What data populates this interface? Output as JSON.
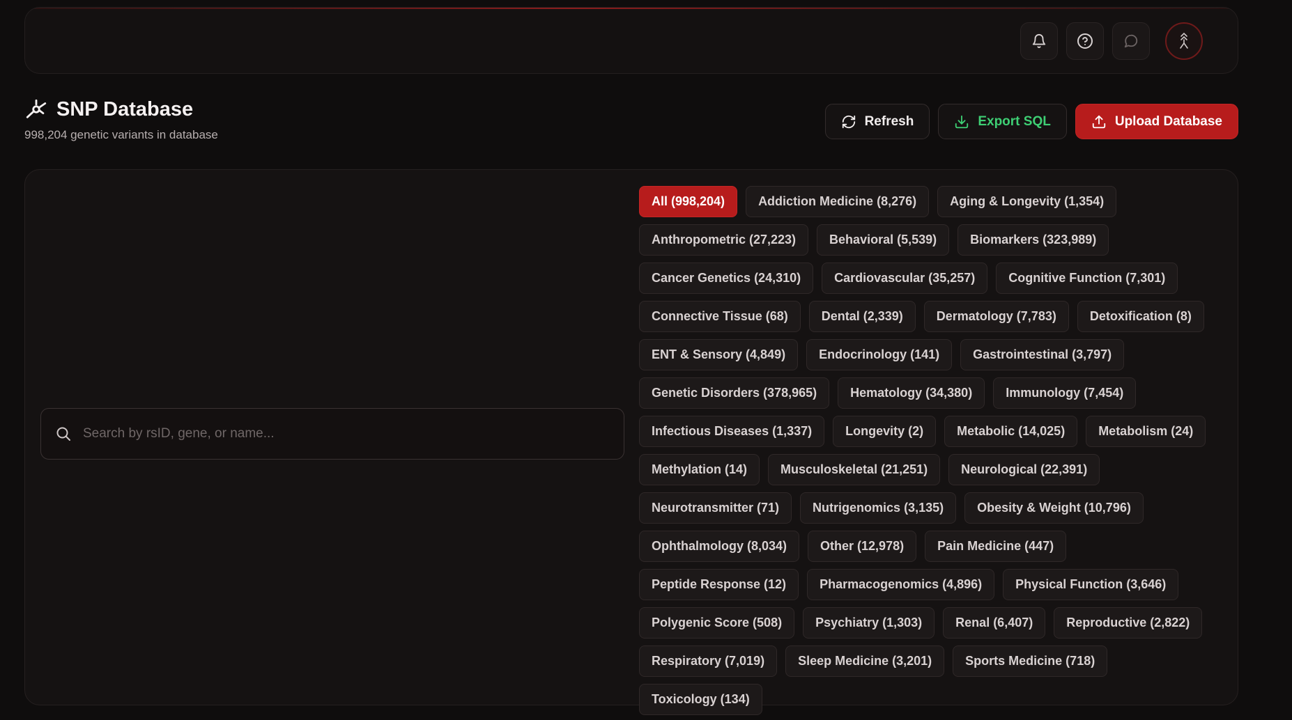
{
  "topbar": {
    "icons": [
      "bell-icon",
      "help-circle-icon",
      "chat-bubble-icon",
      "avatar-icon"
    ]
  },
  "header": {
    "title": "SNP Database",
    "subtitle": "998,204 genetic variants in database",
    "icon": "dna-node-icon"
  },
  "actions": {
    "refresh_label": "Refresh",
    "export_label": "Export SQL",
    "upload_label": "Upload Database"
  },
  "colors": {
    "accent": "#b71c1c",
    "export_green": "#3ecf74",
    "background": "#0f0d0d"
  },
  "search": {
    "placeholder": "Search by rsID, gene, or name...",
    "value": ""
  },
  "categories": [
    {
      "label": "All (998,204)",
      "active": true
    },
    {
      "label": "Addiction Medicine (8,276)"
    },
    {
      "label": "Aging & Longevity (1,354)"
    },
    {
      "label": "Anthropometric (27,223)"
    },
    {
      "label": "Behavioral (5,539)"
    },
    {
      "label": "Biomarkers (323,989)"
    },
    {
      "label": "Cancer Genetics (24,310)"
    },
    {
      "label": "Cardiovascular (35,257)"
    },
    {
      "label": "Cognitive Function (7,301)"
    },
    {
      "label": "Connective Tissue (68)"
    },
    {
      "label": "Dental (2,339)"
    },
    {
      "label": "Dermatology (7,783)"
    },
    {
      "label": "Detoxification (8)"
    },
    {
      "label": "ENT & Sensory (4,849)"
    },
    {
      "label": "Endocrinology (141)"
    },
    {
      "label": "Gastrointestinal (3,797)"
    },
    {
      "label": "Genetic Disorders (378,965)"
    },
    {
      "label": "Hematology (34,380)"
    },
    {
      "label": "Immunology (7,454)"
    },
    {
      "label": "Infectious Diseases (1,337)"
    },
    {
      "label": "Longevity (2)"
    },
    {
      "label": "Metabolic (14,025)"
    },
    {
      "label": "Metabolism (24)"
    },
    {
      "label": "Methylation (14)"
    },
    {
      "label": "Musculoskeletal (21,251)"
    },
    {
      "label": "Neurological (22,391)"
    },
    {
      "label": "Neurotransmitter (71)"
    },
    {
      "label": "Nutrigenomics (3,135)"
    },
    {
      "label": "Obesity & Weight (10,796)"
    },
    {
      "label": "Ophthalmology (8,034)"
    },
    {
      "label": "Other (12,978)"
    },
    {
      "label": "Pain Medicine (447)"
    },
    {
      "label": "Peptide Response (12)"
    },
    {
      "label": "Pharmacogenomics (4,896)"
    },
    {
      "label": "Physical Function (3,646)"
    },
    {
      "label": "Polygenic Score (508)"
    },
    {
      "label": "Psychiatry (1,303)"
    },
    {
      "label": "Renal (6,407)"
    },
    {
      "label": "Reproductive (2,822)"
    },
    {
      "label": "Respiratory (7,019)"
    },
    {
      "label": "Sleep Medicine (3,201)"
    },
    {
      "label": "Sports Medicine (718)"
    },
    {
      "label": "Toxicology (134)"
    }
  ]
}
